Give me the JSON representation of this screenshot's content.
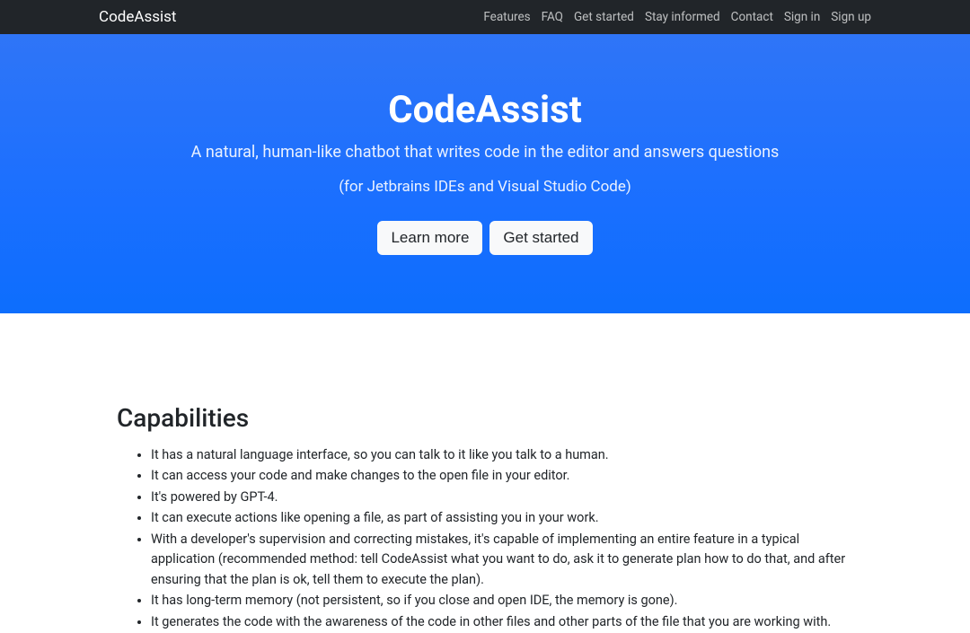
{
  "nav": {
    "brand": "CodeAssist",
    "links": [
      "Features",
      "FAQ",
      "Get started",
      "Stay informed",
      "Contact",
      "Sign in",
      "Sign up"
    ]
  },
  "hero": {
    "title": "CodeAssist",
    "subtitle": "A natural, human-like chatbot that writes code in the editor and answers questions",
    "subtext": "(for Jetbrains IDEs and Visual Studio Code)",
    "buttons": {
      "learn_more": "Learn more",
      "get_started": "Get started"
    }
  },
  "capabilities": {
    "heading": "Capabilities",
    "items": [
      "It has a natural language interface, so you can talk to it like you talk to a human.",
      "It can access your code and make changes to the open file in your editor.",
      "It's powered by GPT-4.",
      "It can execute actions like opening a file, as part of assisting you in your work.",
      "With a developer's supervision and correcting mistakes, it's capable of implementing an entire feature in a typical application (recommended method: tell CodeAssist what you want to do, ask it to generate plan how to do that, and after ensuring that the plan is ok, tell them to execute the plan).",
      "It has long-term memory (not persistent, so if you close and open IDE, the memory is gone).",
      "It generates the code with the awareness of the code in other files and other parts of the file that you are working with."
    ]
  }
}
